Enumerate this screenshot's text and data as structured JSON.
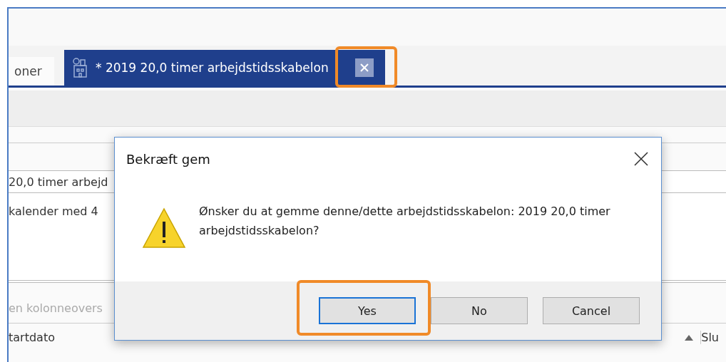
{
  "tabs": [
    {
      "label": "oner",
      "selected": false,
      "callout": false
    },
    {
      "label": "* 2019 20,0 timer arbejdstidsskabelon",
      "selected": true,
      "callout": true
    }
  ],
  "form": {
    "name_value": "20,0 timer arbejd",
    "description": "kalender med 4",
    "group_hint": "en kolonneovers"
  },
  "table": {
    "columns": [
      {
        "label": "tartdato",
        "sorted": true
      },
      {
        "label": "Slu",
        "sorted": false
      }
    ]
  },
  "dialog": {
    "title": "Bekræft gem",
    "message": "Ønsker du at gemme denne/dette arbejdstidsskabelon: 2019 20,0 timer arbejdstidsskabelon?",
    "buttons": [
      {
        "label": "Yes",
        "focused": true,
        "callout": true
      },
      {
        "label": "No",
        "focused": false,
        "callout": false
      },
      {
        "label": "Cancel",
        "focused": false,
        "callout": false
      }
    ]
  }
}
